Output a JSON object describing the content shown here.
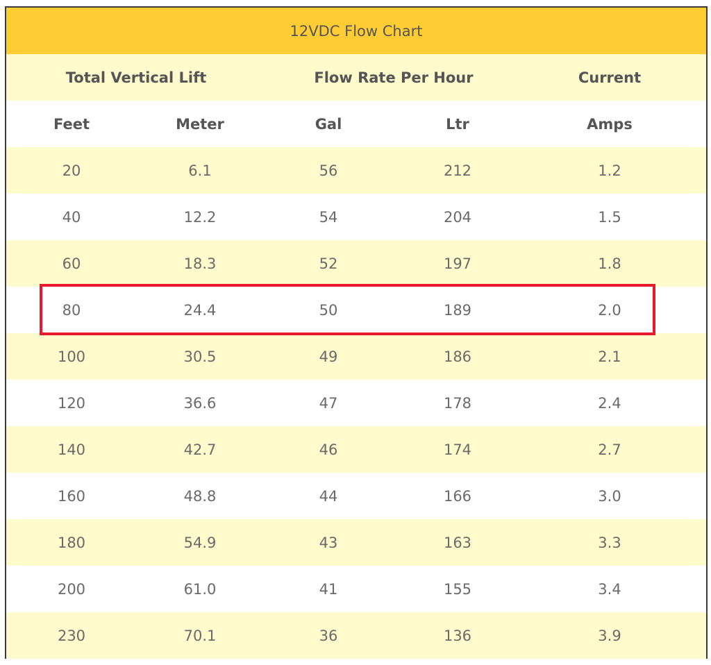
{
  "table": {
    "title": "12VDC Flow Chart",
    "group_headers": [
      "Total Vertical Lift",
      "Flow Rate Per Hour",
      "Current"
    ],
    "unit_headers": [
      "Feet",
      "Meter",
      "Gal",
      "Ltr",
      "Amps"
    ],
    "rows": [
      [
        "20",
        "6.1",
        "56",
        "212",
        "1.2"
      ],
      [
        "40",
        "12.2",
        "54",
        "204",
        "1.5"
      ],
      [
        "60",
        "18.3",
        "52",
        "197",
        "1.8"
      ],
      [
        "80",
        "24.4",
        "50",
        "189",
        "2.0"
      ],
      [
        "100",
        "30.5",
        "49",
        "186",
        "2.1"
      ],
      [
        "120",
        "36.6",
        "47",
        "178",
        "2.4"
      ],
      [
        "140",
        "42.7",
        "46",
        "174",
        "2.7"
      ],
      [
        "160",
        "48.8",
        "44",
        "166",
        "3.0"
      ],
      [
        "180",
        "54.9",
        "43",
        "163",
        "3.3"
      ],
      [
        "200",
        "61.0",
        "41",
        "155",
        "3.4"
      ],
      [
        "230",
        "70.1",
        "36",
        "136",
        "3.9"
      ]
    ],
    "highlighted_row": 3
  },
  "colors": {
    "title_bg": "#ffcc33",
    "stripe_bg": "#fffbcc",
    "highlight_border": "#e8192c"
  }
}
